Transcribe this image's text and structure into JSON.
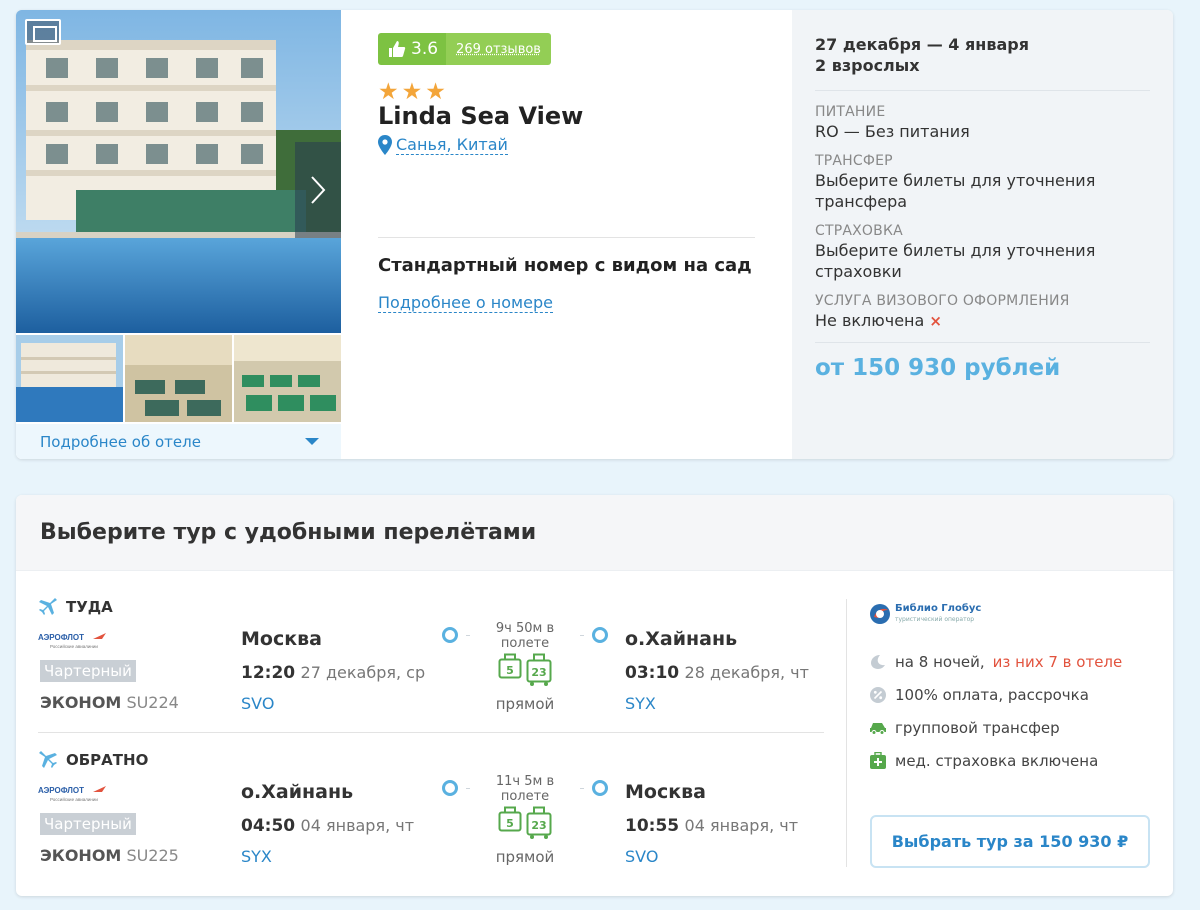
{
  "hotel": {
    "rating_score": "3.6",
    "reviews": "269 отзывов",
    "stars": 3,
    "name": "Linda Sea View",
    "location": "Санья, Китай",
    "room_name": "Стандартный номер с видом на сад",
    "room_more": "Подробнее о номере",
    "more_hotel": "Подробнее об отеле"
  },
  "booking": {
    "dates": "27 декабря — 4 января",
    "guests": "2 взрослых",
    "meals_label": "ПИТАНИЕ",
    "meals_value": "RO — Без питания",
    "transfer_label": "ТРАНСФЕР",
    "transfer_value": "Выберите билеты для уточнения трансфера",
    "insurance_label": "СТРАХОВКА",
    "insurance_value": "Выберите билеты для уточнения страховки",
    "visa_label": "УСЛУГА ВИЗОВОГО ОФОРМЛЕНИЯ",
    "visa_value": "Не включена",
    "visa_mark": "×",
    "price": "от 150 930 рублей"
  },
  "flights": {
    "title": "Выберите тур с удобными перелётами",
    "outbound": {
      "label": "ТУДА",
      "airline": "АЭРОФЛОТ",
      "airline_sub": "Российские авиалинии",
      "charter": "Чартерный",
      "class": "ЭКОНОМ",
      "flight": "SU224",
      "from_city": "Москва",
      "from_time": "12:20",
      "from_date": "27 декабря, ср",
      "from_code": "SVO",
      "duration": "9ч 50м в полете",
      "bag": "5",
      "luggage": "23",
      "direct": "прямой",
      "to_city": "о.Хайнань",
      "to_time": "03:10",
      "to_date": "28 декабря, чт",
      "to_code": "SYX"
    },
    "return": {
      "label": "ОБРАТНО",
      "airline": "АЭРОФЛОТ",
      "airline_sub": "Российские авиалинии",
      "charter": "Чартерный",
      "class": "ЭКОНОМ",
      "flight": "SU225",
      "from_city": "о.Хайнань",
      "from_time": "04:50",
      "from_date": "04 января, чт",
      "from_code": "SYX",
      "duration": "11ч 5м в полете",
      "bag": "5",
      "luggage": "23",
      "direct": "прямой",
      "to_city": "Москва",
      "to_time": "10:55",
      "to_date": "04 января, чт",
      "to_code": "SVO"
    }
  },
  "tour": {
    "operator": "Библио Глобус",
    "operator_sub": "туристический оператор",
    "nights": "на 8 ночей,",
    "nights_hotel": "из них 7 в отеле",
    "payment": "100% оплата, рассрочка",
    "transfer": "групповой трансфер",
    "insurance": "мед. страховка включена",
    "select_button": "Выбрать тур за 150 930 ₽"
  },
  "colors": {
    "accent": "#2a86c8",
    "rating_green": "#7dc242",
    "star": "#f3a53a",
    "price": "#5ab1e0",
    "highlight_red": "#e2533e"
  }
}
